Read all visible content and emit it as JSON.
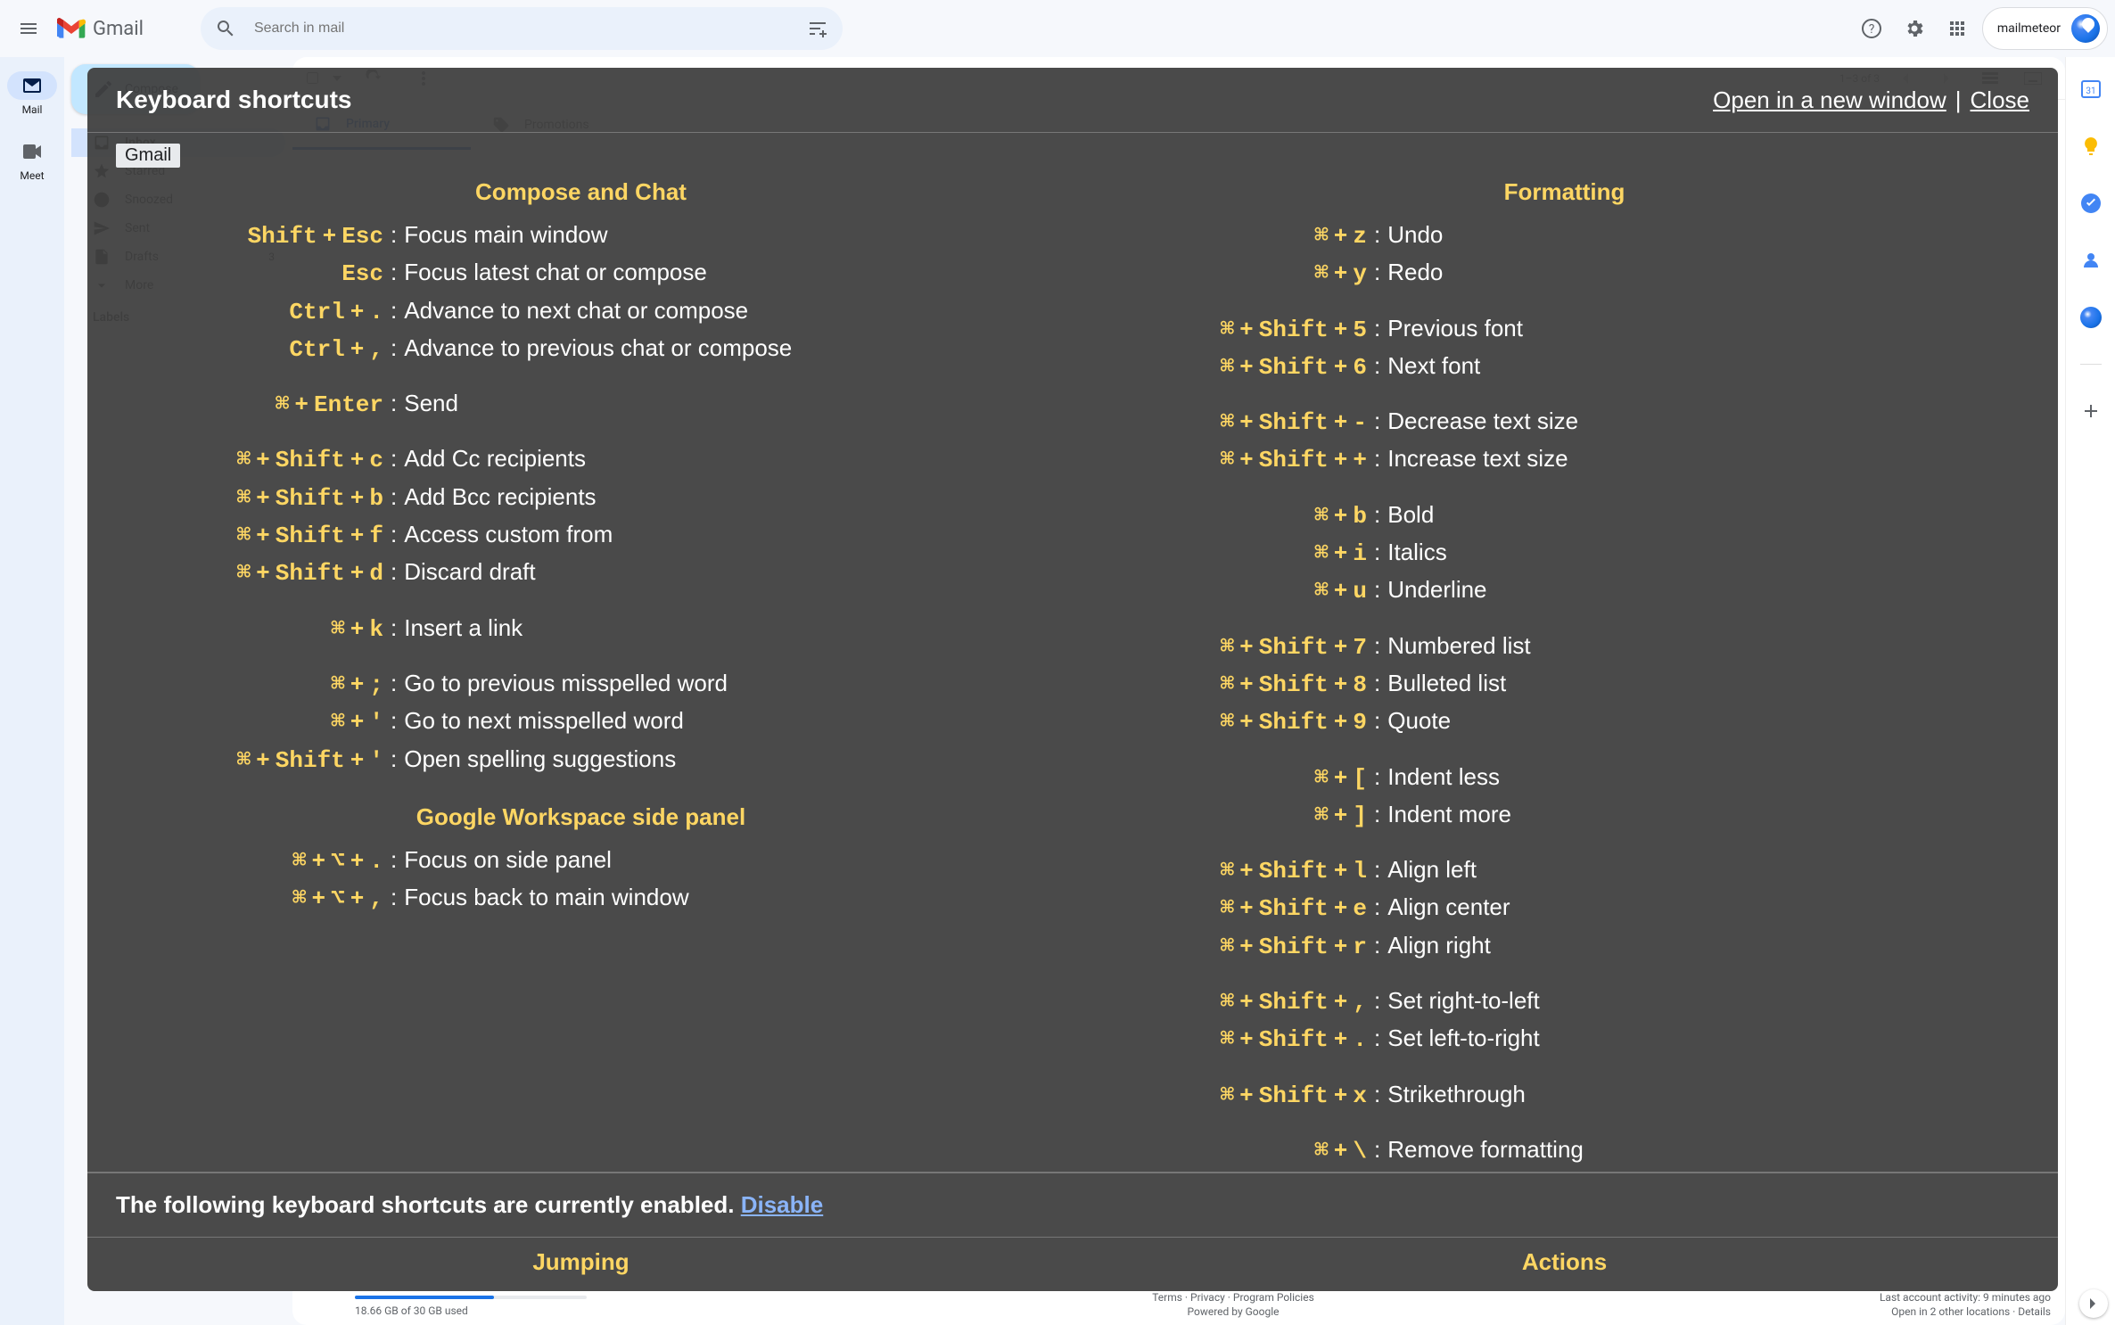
{
  "header": {
    "logo_text": "Gmail",
    "search_placeholder": "Search in mail",
    "account_name": "mailmeteor"
  },
  "leftrail": {
    "mail": "Mail",
    "meet": "Meet"
  },
  "sidebar": {
    "compose": "Compose",
    "folders": [
      {
        "label": "Inbox",
        "count": ""
      },
      {
        "label": "Starred",
        "count": ""
      },
      {
        "label": "Snoozed",
        "count": ""
      },
      {
        "label": "Sent",
        "count": ""
      },
      {
        "label": "Drafts",
        "count": "3"
      },
      {
        "label": "More",
        "count": ""
      }
    ],
    "labels_head": "Labels"
  },
  "toolbar": {
    "range": "1–3 of 3"
  },
  "tabs": {
    "primary": "Primary",
    "promotions": "Promotions"
  },
  "footer": {
    "storage": "18.66 GB of 30 GB used",
    "terms": "Terms · Privacy · Program Policies",
    "powered": "Powered by Google",
    "activity": "Last account activity: 9 minutes ago",
    "locations": "Open in 2 other locations · Details"
  },
  "ks": {
    "title": "Keyboard shortcuts",
    "open_new": "Open in a new window",
    "close": "Close",
    "chip": "Gmail",
    "enabled_text": "The following keyboard shortcuts are currently enabled. ",
    "disable": "Disable",
    "sections": {
      "compose": {
        "title": "Compose and Chat",
        "rows": [
          {
            "keys": [
              "Shift",
              "Esc"
            ],
            "desc": "Focus main window"
          },
          {
            "keys": [
              "Esc"
            ],
            "desc": "Focus latest chat or compose"
          },
          {
            "keys": [
              "Ctrl",
              "."
            ],
            "desc": "Advance to next chat or compose"
          },
          {
            "keys": [
              "Ctrl",
              ","
            ],
            "desc": "Advance to previous chat or compose"
          },
          {
            "spacer": true
          },
          {
            "keys": [
              "⌘",
              "Enter"
            ],
            "desc": "Send"
          },
          {
            "spacer": true
          },
          {
            "keys": [
              "⌘",
              "Shift",
              "c"
            ],
            "desc": "Add Cc recipients"
          },
          {
            "keys": [
              "⌘",
              "Shift",
              "b"
            ],
            "desc": "Add Bcc recipients"
          },
          {
            "keys": [
              "⌘",
              "Shift",
              "f"
            ],
            "desc": "Access custom from"
          },
          {
            "keys": [
              "⌘",
              "Shift",
              "d"
            ],
            "desc": "Discard draft"
          },
          {
            "spacer": true
          },
          {
            "keys": [
              "⌘",
              "k"
            ],
            "desc": "Insert a link"
          },
          {
            "spacer": true
          },
          {
            "keys": [
              "⌘",
              ";"
            ],
            "desc": "Go to previous misspelled word"
          },
          {
            "keys": [
              "⌘",
              "'"
            ],
            "desc": "Go to next misspelled word"
          },
          {
            "keys": [
              "⌘",
              "Shift",
              "'"
            ],
            "desc": "Open spelling suggestions"
          }
        ]
      },
      "sidepanel": {
        "title": "Google Workspace side panel",
        "rows": [
          {
            "keys": [
              "⌘",
              "⌥",
              "."
            ],
            "desc": "Focus on side panel"
          },
          {
            "keys": [
              "⌘",
              "⌥",
              ","
            ],
            "desc": "Focus back to main window"
          }
        ]
      },
      "formatting": {
        "title": "Formatting",
        "rows": [
          {
            "keys": [
              "⌘",
              "z"
            ],
            "desc": "Undo"
          },
          {
            "keys": [
              "⌘",
              "y"
            ],
            "desc": "Redo"
          },
          {
            "spacer": true
          },
          {
            "keys": [
              "⌘",
              "Shift",
              "5"
            ],
            "desc": "Previous font"
          },
          {
            "keys": [
              "⌘",
              "Shift",
              "6"
            ],
            "desc": "Next font"
          },
          {
            "spacer": true
          },
          {
            "keys": [
              "⌘",
              "Shift",
              "-"
            ],
            "desc": "Decrease text size"
          },
          {
            "keys": [
              "⌘",
              "Shift",
              "+"
            ],
            "desc": "Increase text size"
          },
          {
            "spacer": true
          },
          {
            "keys": [
              "⌘",
              "b"
            ],
            "desc": "Bold"
          },
          {
            "keys": [
              "⌘",
              "i"
            ],
            "desc": "Italics"
          },
          {
            "keys": [
              "⌘",
              "u"
            ],
            "desc": "Underline"
          },
          {
            "spacer": true
          },
          {
            "keys": [
              "⌘",
              "Shift",
              "7"
            ],
            "desc": "Numbered list"
          },
          {
            "keys": [
              "⌘",
              "Shift",
              "8"
            ],
            "desc": "Bulleted list"
          },
          {
            "keys": [
              "⌘",
              "Shift",
              "9"
            ],
            "desc": "Quote"
          },
          {
            "spacer": true
          },
          {
            "keys": [
              "⌘",
              "["
            ],
            "desc": "Indent less"
          },
          {
            "keys": [
              "⌘",
              "]"
            ],
            "desc": "Indent more"
          },
          {
            "spacer": true
          },
          {
            "keys": [
              "⌘",
              "Shift",
              "l"
            ],
            "desc": "Align left"
          },
          {
            "keys": [
              "⌘",
              "Shift",
              "e"
            ],
            "desc": "Align center"
          },
          {
            "keys": [
              "⌘",
              "Shift",
              "r"
            ],
            "desc": "Align right"
          },
          {
            "spacer": true
          },
          {
            "keys": [
              "⌘",
              "Shift",
              ","
            ],
            "desc": "Set right-to-left"
          },
          {
            "keys": [
              "⌘",
              "Shift",
              "."
            ],
            "desc": "Set left-to-right"
          },
          {
            "spacer": true
          },
          {
            "keys": [
              "⌘",
              "Shift",
              "x"
            ],
            "desc": "Strikethrough"
          },
          {
            "spacer": true
          },
          {
            "keys": [
              "⌘",
              "\\"
            ],
            "desc": "Remove formatting"
          }
        ]
      },
      "jumping": {
        "title": "Jumping"
      },
      "actions": {
        "title": "Actions"
      }
    }
  }
}
